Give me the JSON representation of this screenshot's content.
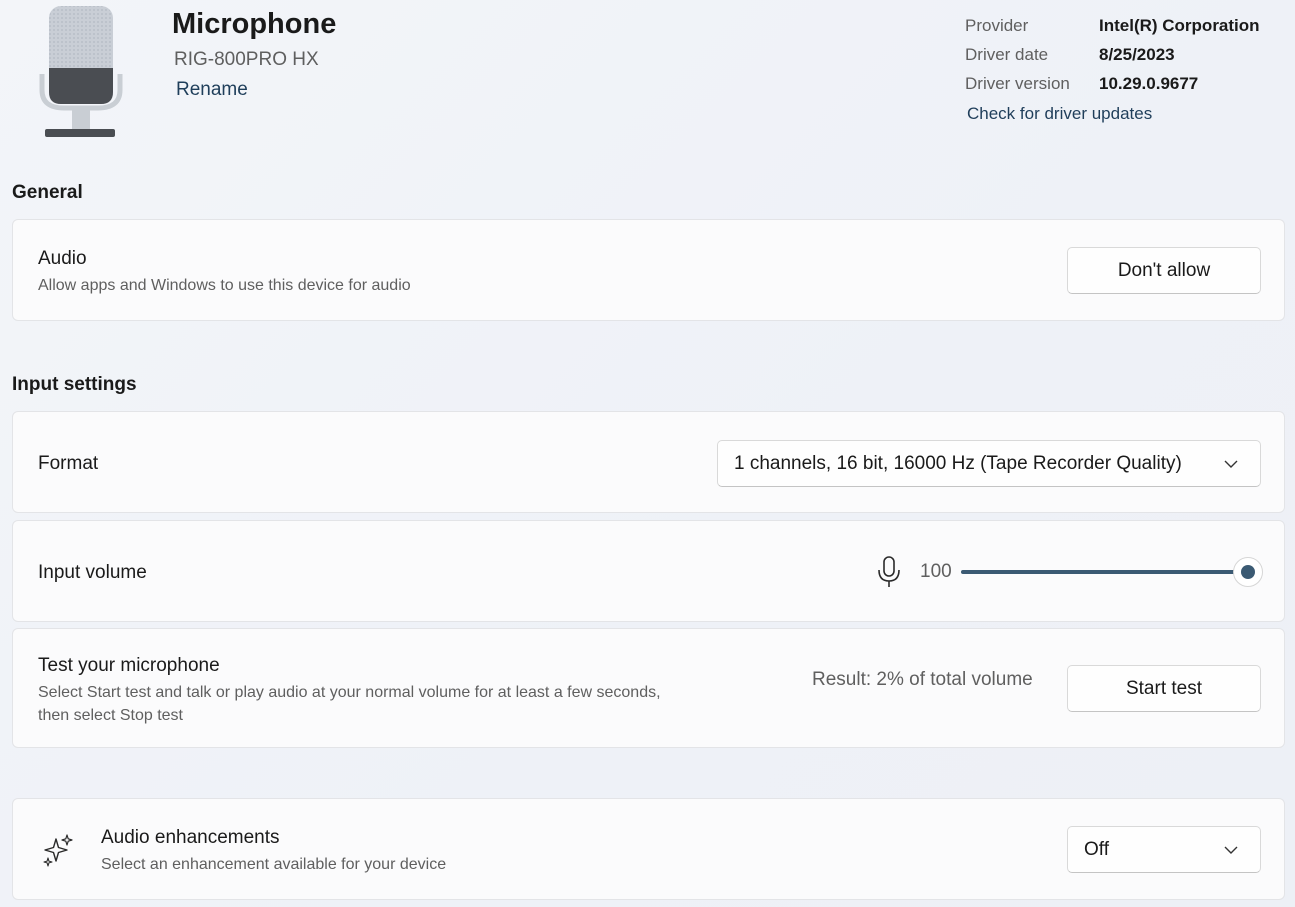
{
  "header": {
    "title": "Microphone",
    "model": "RIG-800PRO HX",
    "rename": "Rename",
    "provider_label": "Provider",
    "provider_value": "Intel(R) Corporation",
    "driver_date_label": "Driver date",
    "driver_date_value": "8/25/2023",
    "driver_version_label": "Driver version",
    "driver_version_value": "10.29.0.9677",
    "driver_update_link": "Check for driver updates"
  },
  "general": {
    "section_title": "General",
    "audio_title": "Audio",
    "audio_sub": "Allow apps and Windows to use this device for audio",
    "audio_button": "Don't allow"
  },
  "input": {
    "section_title": "Input settings",
    "format_title": "Format",
    "format_value": "1 channels, 16 bit, 16000 Hz (Tape Recorder Quality)",
    "volume_title": "Input volume",
    "volume_value": "100",
    "volume_level": 100,
    "test_title": "Test your microphone",
    "test_sub_line1": "Select Start test and talk or play audio at your normal volume for at least a few seconds,",
    "test_sub_line2": "then select Stop test",
    "test_result": "Result: 2% of total volume",
    "test_button": "Start test"
  },
  "enhancements": {
    "title": "Audio enhancements",
    "sub": "Select an enhancement available for your device",
    "value": "Off"
  },
  "icons": {
    "device": "microphone-illustration",
    "volume": "microphone-icon",
    "enhancements": "sparkle-icon",
    "dropdown": "chevron-down-icon"
  },
  "colors": {
    "accent": "#3b5a73",
    "link": "#1f3e5a"
  }
}
